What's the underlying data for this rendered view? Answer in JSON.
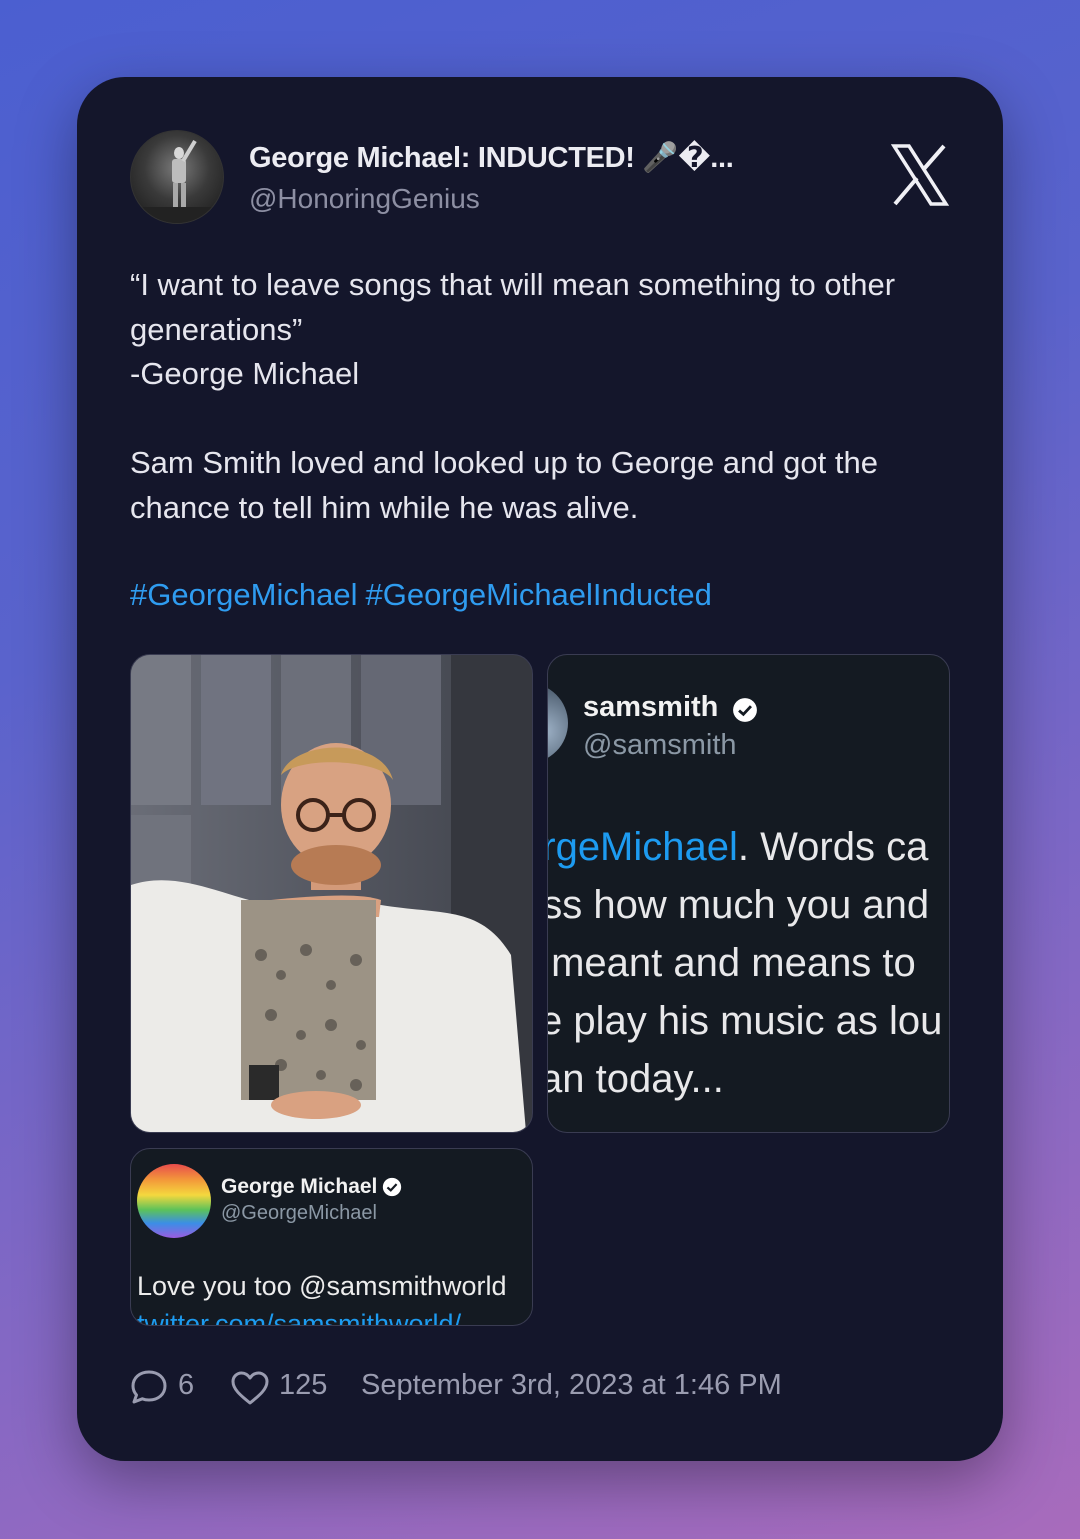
{
  "author": {
    "display_name": "George Michael: INDUCTED! 🎤�...",
    "handle": "@HonoringGenius"
  },
  "tweet": {
    "line1": "“I want to leave songs that will mean something to other generations”",
    "line2": "-George Michael",
    "line3": "Sam Smith loved and looked up to George and got the chance to tell him while he was alive.",
    "hashtags": [
      "#GeorgeMichael",
      "#GeorgeMichaelInducted"
    ]
  },
  "media": {
    "screenshot1": {
      "name": "samsmith",
      "handle": "@samsmith",
      "line1_link": "orgeMichael",
      "line1_rest": ". Words ca",
      "line2": "ess how much you and",
      "line3": "c meant and means to",
      "line4": "se play his music as lou",
      "line5": "can today..."
    },
    "screenshot2": {
      "name": "George Michael",
      "handle": "@GeorgeMichael",
      "text": "Love you too @samsmithworld",
      "link_cut": "twitter.com/samsmithworld/"
    }
  },
  "footer": {
    "replies": "6",
    "likes": "125",
    "timestamp": "September 3rd, 2023 at 1:46 PM"
  },
  "colors": {
    "card": "#14162b",
    "link": "#2f9cf0"
  }
}
